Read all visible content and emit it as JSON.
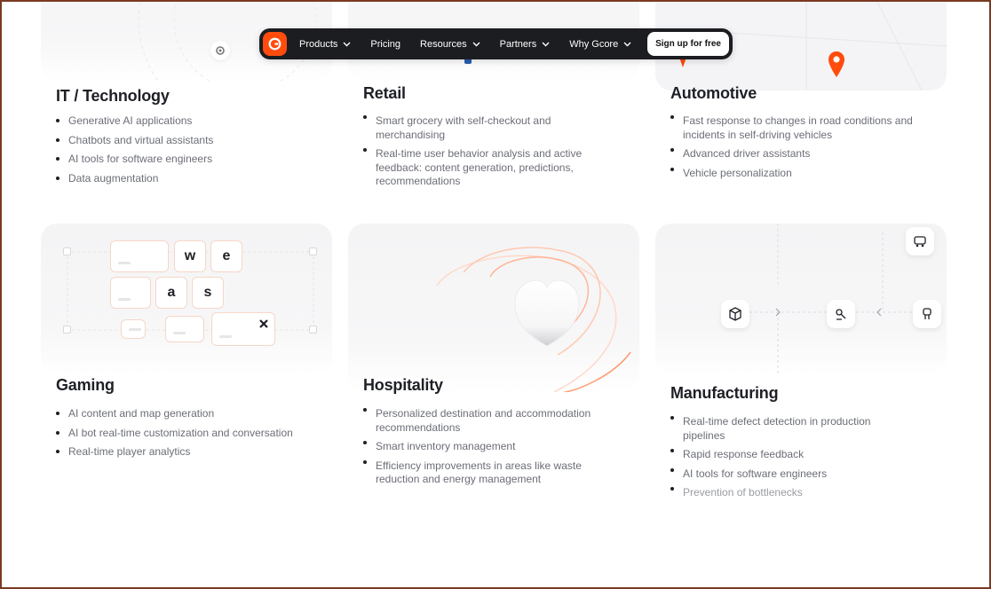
{
  "nav": {
    "items": [
      {
        "label": "Products",
        "dropdown": true
      },
      {
        "label": "Pricing",
        "dropdown": false
      },
      {
        "label": "Resources",
        "dropdown": true
      },
      {
        "label": "Partners",
        "dropdown": true
      },
      {
        "label": "Why Gcore",
        "dropdown": true
      }
    ],
    "cta": "Sign up for free",
    "logo_color": "#ff4c0d"
  },
  "industries": [
    {
      "title": "IT / Technology",
      "bullets": [
        "Generative AI applications",
        "Chatbots and virtual assistants",
        "AI tools for software engineers",
        "Data augmentation"
      ]
    },
    {
      "title": "Retail",
      "bullets": [
        "Smart grocery with self-checkout and merchandising",
        "Real-time user behavior analysis and active feedback: content generation, predictions, recommendations"
      ]
    },
    {
      "title": "Automotive",
      "bullets": [
        "Fast response to changes in road conditions and incidents in self-driving vehicles",
        "Advanced driver assistants",
        "Vehicle personalization"
      ]
    },
    {
      "title": "Gaming",
      "keys": [
        "w",
        "e",
        "a",
        "s"
      ],
      "bullets": [
        "AI content and map generation",
        "AI bot real-time customization and conversation",
        "Real-time player analytics"
      ]
    },
    {
      "title": "Hospitality",
      "bullets": [
        "Personalized destination and accommodation recommendations",
        "Smart inventory management",
        "Efficiency improvements in areas like waste reduction and energy management"
      ]
    },
    {
      "title": "Manufacturing",
      "bullets": [
        "Real-time defect detection in production pipelines",
        "Rapid response feedback",
        "AI tools for software engineers",
        "Prevention of bottlenecks"
      ]
    }
  ],
  "accent": "#ff4c0d"
}
